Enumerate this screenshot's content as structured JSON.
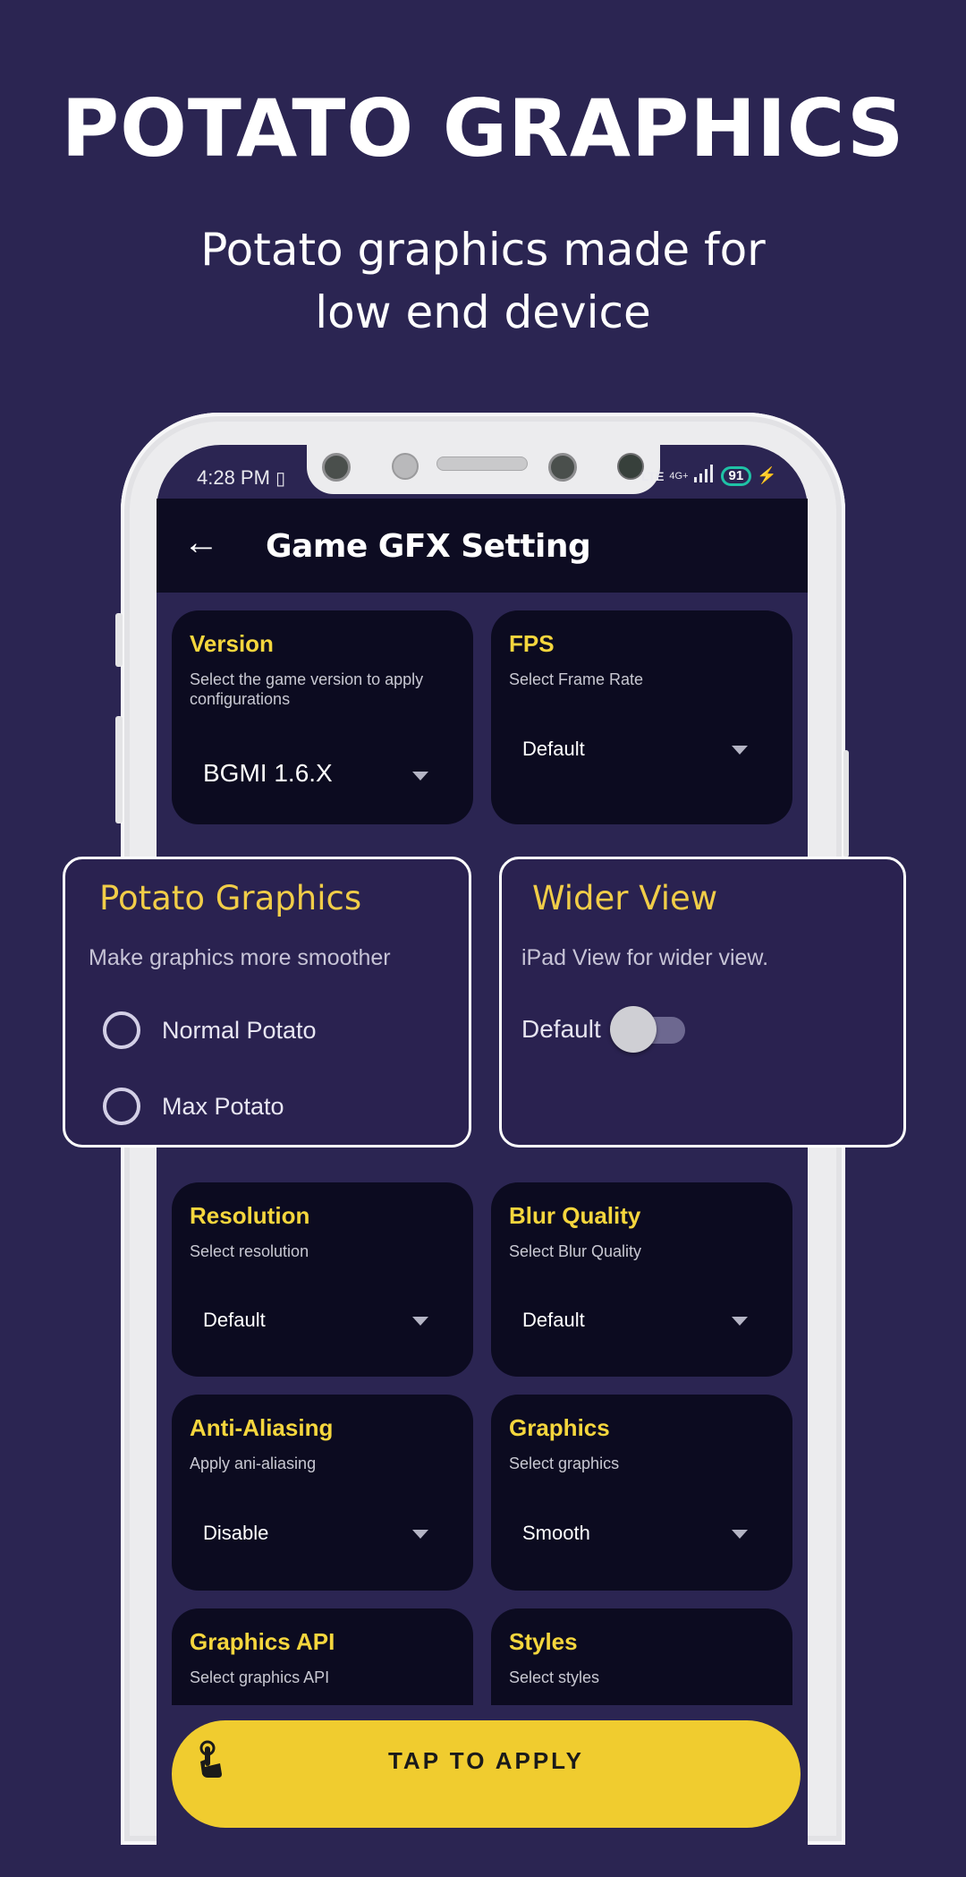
{
  "promo": {
    "headline": "POTATO GRAPHICS",
    "subline_line1": "Potato graphics made for",
    "subline_line2": "low end device"
  },
  "status_bar": {
    "time": "4:28 PM",
    "left_icons": "vibrate-icon",
    "network": "4G+",
    "volte": "LTE",
    "battery": "91",
    "charging_icon": "bolt-icon"
  },
  "appbar": {
    "back_icon": "←",
    "title": "Game GFX Setting"
  },
  "cards": [
    {
      "id": "version",
      "title": "Version",
      "desc": "Select the game version to apply configurations",
      "value": "BGMI 1.6.X"
    },
    {
      "id": "fps",
      "title": "FPS",
      "desc": "Select Frame Rate",
      "value": "Default"
    },
    {
      "id": "resolution",
      "title": "Resolution",
      "desc": "Select resolution",
      "value": "Default"
    },
    {
      "id": "blur-quality",
      "title": "Blur Quality",
      "desc": "Select Blur Quality",
      "value": "Default"
    },
    {
      "id": "anti-aliasing",
      "title": "Anti-Aliasing",
      "desc": "Apply ani-aliasing",
      "value": "Disable"
    },
    {
      "id": "graphics",
      "title": "Graphics",
      "desc": "Select graphics",
      "value": "Smooth"
    },
    {
      "id": "graphics-api",
      "title": "Graphics API",
      "desc": "Select graphics API"
    },
    {
      "id": "styles",
      "title": "Styles",
      "desc": "Select  styles"
    }
  ],
  "potato_callout": {
    "title": "Potato Graphics",
    "desc": "Make graphics more smoother",
    "options": [
      {
        "label": "Normal Potato",
        "selected": false
      },
      {
        "label": "Max Potato",
        "selected": false
      }
    ]
  },
  "wider_callout": {
    "title": "Wider View",
    "desc": "iPad View for wider view.",
    "toggle_label": "Default",
    "toggle_on": false
  },
  "apply_button": {
    "label": "TAP TO APPLY",
    "icon": "tap-hand-icon"
  },
  "colors": {
    "background": "#2b2552",
    "appbar": "#0d0c22",
    "card": "#0c0b20",
    "accent_yellow": "#f5d63d",
    "button_yellow": "#f0cc2f",
    "battery_teal": "#1fc2a6"
  }
}
